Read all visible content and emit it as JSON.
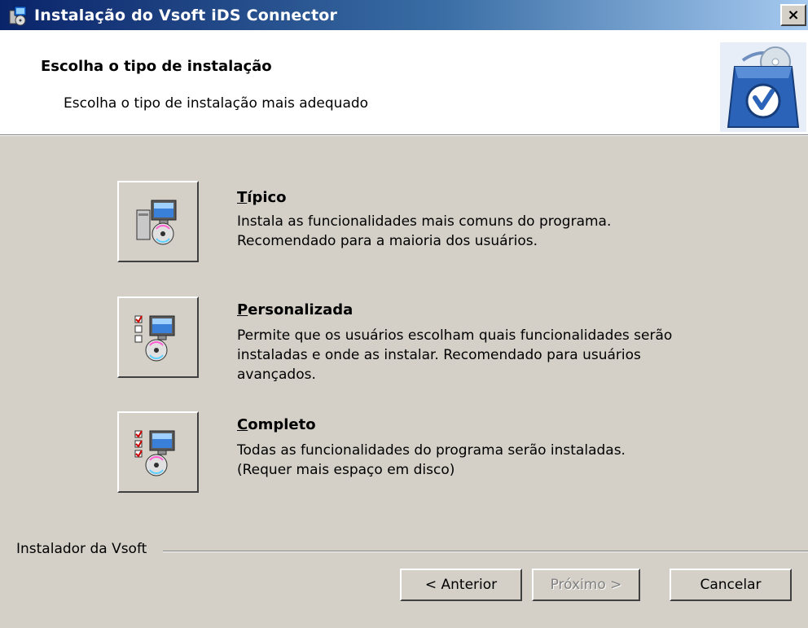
{
  "window": {
    "title": "Instalação do Vsoft iDS Connector",
    "close_label": "×"
  },
  "header": {
    "title": "Escolha o tipo de instalação",
    "subtitle": "Escolha o tipo de instalação mais adequado"
  },
  "options": [
    {
      "title_hotkey": "T",
      "title_rest": "ípico",
      "desc_lines": [
        "Instala as funcionalidades mais comuns do programa.",
        "Recomendado para a maioria dos usuários."
      ],
      "icon": "typical-install-icon"
    },
    {
      "title_hotkey": "P",
      "title_rest": "ersonalizada",
      "desc_lines": [
        "Permite que os usuários escolham quais funcionalidades serão",
        "instaladas e onde as instalar. Recomendado para usuários",
        "avançados."
      ],
      "icon": "custom-install-icon"
    },
    {
      "title_hotkey": "C",
      "title_rest": "ompleto",
      "desc_lines": [
        "Todas as funcionalidades do programa serão instaladas.",
        "(Requer mais espaço em disco)"
      ],
      "icon": "complete-install-icon"
    }
  ],
  "footer": {
    "brand": "Instalador da Vsoft",
    "back_label": "< Anterior",
    "next_label": "Próximo >",
    "cancel_label": "Cancelar"
  },
  "colors": {
    "face": "#d4d0c8",
    "title_gradient_start": "#0a246a",
    "title_gradient_end": "#a6caf0"
  }
}
